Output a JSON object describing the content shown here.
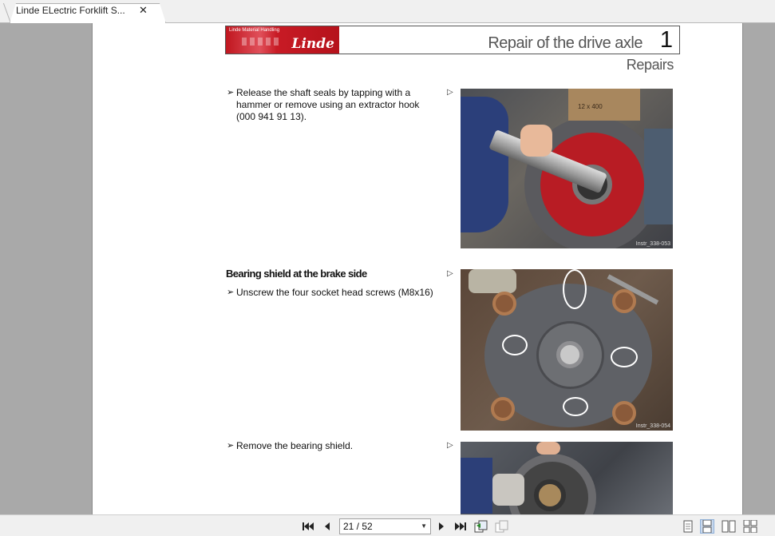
{
  "tab": {
    "title": "Linde ELectric Forklift S...",
    "close": "✕"
  },
  "header": {
    "logo_small": "Linde Material Handling",
    "logo_brand": "Linde",
    "section_title": "Repair of the drive axle",
    "section_number": "1",
    "subsection": "Repairs"
  },
  "content": {
    "step1": {
      "mark": "➢",
      "text": "Release the shaft seals by tapping with a hammer or remove using an extractor hook (000 941 91 13)."
    },
    "photo1": {
      "id": "Instr_338-053",
      "box_label": "12 x 400"
    },
    "heading2": "Bearing shield at the brake side",
    "step2": {
      "mark": "➢",
      "text": "Unscrew the four socket head screws (M8x16)"
    },
    "photo2": {
      "id": "Instr_338-054"
    },
    "step3": {
      "mark": "➢",
      "text": "Remove the bearing shield."
    },
    "ref_arrow": "▷"
  },
  "toolbar": {
    "page_display": "21 / 52",
    "dropdown": "▼"
  },
  "colors": {
    "brand_red": "#c0161f",
    "viewer_bg": "#a9a9a9",
    "selected": "#c9d9ee"
  }
}
